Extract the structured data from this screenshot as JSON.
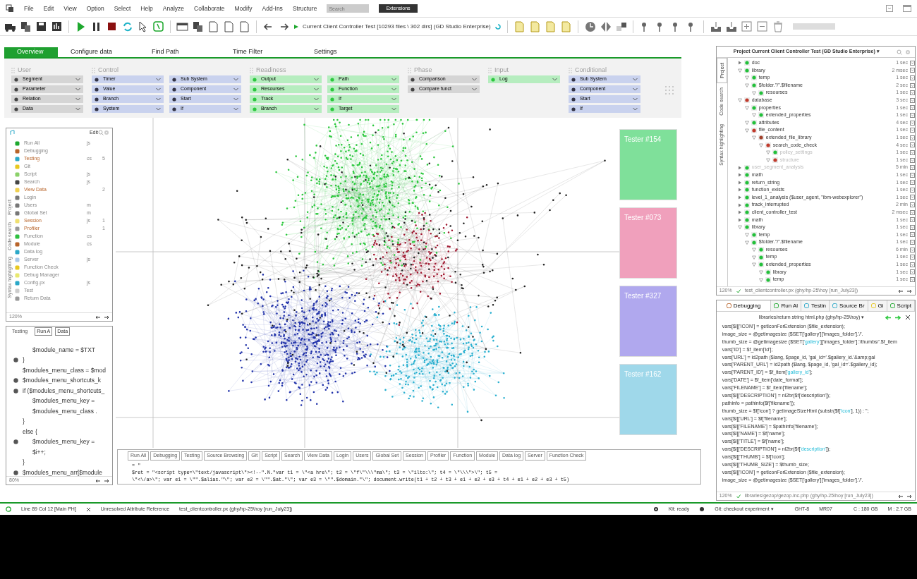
{
  "menu": [
    "File",
    "Edit",
    "View",
    "Option",
    "Select",
    "Help",
    "Analyze",
    "Collaborate",
    "Modify",
    "Add-Ins",
    "Structure"
  ],
  "menu_search": {
    "placeholder": "Search"
  },
  "extensions_button": "Extensions",
  "toolbar": {
    "project_label": "Current Client Controller Test [10293 files \\ 302 dirs] (GD Studio Enterprise)"
  },
  "tabs": [
    {
      "label": "Overview",
      "selected": true
    },
    {
      "label": "Configure data",
      "selected": false
    },
    {
      "label": "Find Path",
      "selected": false
    },
    {
      "label": "Time Filter",
      "selected": false
    },
    {
      "label": "Settings",
      "selected": false
    }
  ],
  "filter_groups": [
    {
      "title": "User",
      "kind": "grey",
      "columns": [
        [
          "Segment",
          "Parameter",
          "Relation",
          "Data"
        ]
      ]
    },
    {
      "title": "Control",
      "kind": "blue",
      "columns": [
        [
          "Timer",
          "Value",
          "Branch",
          "System"
        ],
        [
          "Sub System",
          "Component",
          "Start",
          "If"
        ]
      ]
    },
    {
      "title": "Readiness",
      "kind": "green",
      "columns": [
        [
          "Output",
          "Resourses",
          "Track",
          "Branch"
        ],
        [
          "Path",
          "Function",
          "If",
          "Target"
        ]
      ]
    },
    {
      "title": "Phase",
      "kind": "grey",
      "columns": [
        [
          "Comparison",
          "Compare funct"
        ]
      ]
    },
    {
      "title": "Input",
      "kind": "green",
      "columns": [
        [
          "Log"
        ]
      ]
    },
    {
      "title": "Conditional",
      "kind": "blue",
      "columns": [
        [
          "Sub System",
          "Component",
          "Start",
          "If"
        ]
      ]
    }
  ],
  "left_panel": {
    "header": "Edit",
    "side_tabs": [
      "Project",
      "Code search",
      "Syntax highlighting"
    ],
    "items": [
      {
        "label": "Run All",
        "type": "js",
        "highlighted": false
      },
      {
        "label": "Debugging",
        "highlighted": false
      },
      {
        "label": "Testing",
        "type": "cs",
        "count": "5",
        "highlighted": true
      },
      {
        "label": "Git",
        "highlighted": false
      },
      {
        "label": "Script",
        "type": "js",
        "highlighted": false
      },
      {
        "label": "Search",
        "type": "js",
        "highlighted": false
      },
      {
        "label": "View Data",
        "count": "2",
        "highlighted": true
      },
      {
        "label": "Login",
        "highlighted": false
      },
      {
        "label": "Users",
        "type": "m",
        "highlighted": false
      },
      {
        "label": "Global Set",
        "type": "m",
        "highlighted": false
      },
      {
        "label": "Session",
        "type": "js",
        "count": "1",
        "highlighted": true
      },
      {
        "label": "Profiler",
        "count": "1",
        "highlighted": true
      },
      {
        "label": "Function",
        "type": "cs",
        "highlighted": false
      },
      {
        "label": "Module",
        "type": "cs",
        "highlighted": false
      },
      {
        "label": "Data log",
        "highlighted": false
      },
      {
        "label": "Server",
        "type": "js",
        "highlighted": false
      },
      {
        "label": "Function Check",
        "highlighted": false
      },
      {
        "label": "Debug Manager",
        "highlighted": false
      },
      {
        "label": "Config.px",
        "type": "js",
        "highlighted": false
      },
      {
        "label": "Test",
        "highlighted": false
      },
      {
        "label": "Return Data",
        "highlighted": false
      }
    ],
    "zoom": "120%"
  },
  "code_panel": {
    "tabs": [
      "Testing",
      "Run A",
      "Data"
    ],
    "lines": [
      {
        "text": "$module_name = $TXT",
        "kind": "continued",
        "breakpoint": false
      },
      {
        "text": "}",
        "kind": "statement",
        "breakpoint": true
      },
      {
        "text": "$modules_menu_class = $mod",
        "kind": "statement",
        "breakpoint": false
      },
      {
        "text": "$modules_menu_shortcuts_k",
        "kind": "statement",
        "breakpoint": true
      },
      {
        "text": "if ($modules_menu_shortcuts_",
        "kind": "statement",
        "breakpoint": true,
        "children": [
          {
            "text": "$modules_menu_key =",
            "breakpoint": false
          },
          {
            "text": "$modules_menu_class .",
            "breakpoint": false
          }
        ]
      },
      {
        "text": "}",
        "kind": "statement",
        "breakpoint": false
      },
      {
        "text": "else {",
        "kind": "statement",
        "breakpoint": false,
        "children": [
          {
            "text": "$modules_menu_key =",
            "breakpoint": true
          },
          {
            "text": "$i++;",
            "breakpoint": false
          }
        ]
      },
      {
        "text": "}",
        "kind": "statement",
        "breakpoint": false
      },
      {
        "text": "$modules_menu_arr[$module",
        "kind": "statement",
        "breakpoint": true
      }
    ],
    "zoom": "80%"
  },
  "testers": [
    {
      "title": "Tester #154",
      "color": "#7fe09a"
    },
    {
      "title": "Tester #073",
      "color": "#f0a0bc"
    },
    {
      "title": "Tester #327",
      "color": "#b0a8ee"
    },
    {
      "title": "Tester #162",
      "color": "#9fd8ea"
    }
  ],
  "console": {
    "tabs": [
      "Run All",
      "Debugging",
      "Testing",
      "Source Browsing",
      "Git",
      "Script",
      "Search",
      "View Data",
      "Login",
      "Users",
      "Global Set",
      "Session",
      "Profiler",
      "Function",
      "Module",
      "Data log",
      "Server",
      "Function Check"
    ],
    "lines": [
      "= \"",
      "$ret = \"<script type=\\\"text/javascript\\\"><!--\".N.\"var t1 = \\\"<a hre\\\"; t2 = \\\"f\\\"\\\\\\\"ma\\\"; t3 = \\\"ilto:\\\"; t4 = \\\"\\\\\\\">\\\"; t5 =",
      "\\\"<\\/a>\\\"; var e1 = \\\"\".$alias.\"\\\"; var e2 = \\\"\".$at.\"\\\"; var e3 = \\\"\".$domain.\"\\\"; document.write(t1 + t2 + t3 + e1 + e2 + e3 + t4 + e1 + e2 + e3 + t5)"
    ]
  },
  "project_panel": {
    "title": "Project Current Client Controller Test  (GD Studio Enterprise) ▾",
    "side_tabs": [
      {
        "label": "Project",
        "selected": true
      },
      {
        "label": "Code search",
        "selected": false
      },
      {
        "label": "Syntax highlighting",
        "selected": false
      }
    ],
    "tree": [
      {
        "label": "doc",
        "time": "1 sec",
        "color": "#22c03a",
        "expanded": false,
        "dimmed": false
      },
      {
        "label": "library",
        "time": "2 msec",
        "color": "#22c03a",
        "expanded": true,
        "dimmed": false,
        "children": [
          {
            "label": "temp",
            "time": "1 sec",
            "color": "#22c03a",
            "expanded": true,
            "dimmed": false
          },
          {
            "label": "$folder.\"/\".$filename",
            "time": "2 sec",
            "color": "#22c03a",
            "expanded": true,
            "dimmed": false,
            "children": [
              {
                "label": "resourses",
                "time": "1 sec",
                "color": "#22c03a",
                "expanded": true,
                "dimmed": false
              }
            ]
          }
        ]
      },
      {
        "label": "database",
        "time": "3 sec",
        "color": "#c0392b",
        "expanded": true,
        "dimmed": false,
        "children": [
          {
            "label": "properties",
            "time": "1 sec",
            "color": "#22c03a",
            "expanded": true,
            "dimmed": false,
            "children": [
              {
                "label": "extended_properties",
                "time": "1 sec",
                "color": "#22c03a",
                "expanded": true,
                "dimmed": false
              }
            ]
          },
          {
            "label": "attributes",
            "time": "4 sec",
            "color": "#22c03a",
            "expanded": true,
            "dimmed": false
          },
          {
            "label": "file_content",
            "time": "1 sec",
            "color": "#c0392b",
            "expanded": true,
            "dimmed": false,
            "children": [
              {
                "label": "extended_file_library",
                "time": "1 sec",
                "color": "#a0402a",
                "expanded": true,
                "dimmed": false,
                "children": [
                  {
                    "label": "search_code_check",
                    "time": "4 sec",
                    "color": "#c0392b",
                    "expanded": true,
                    "dimmed": false,
                    "children": [
                      {
                        "label": "policy_settings",
                        "time": "1 sec",
                        "color": "#22c03a",
                        "expanded": true,
                        "dimmed": true
                      },
                      {
                        "label": "structure",
                        "time": "1 sec",
                        "color": "#c0392b",
                        "expanded": true,
                        "dimmed": true
                      }
                    ]
                  }
                ]
              }
            ]
          }
        ]
      },
      {
        "label": "user_segment_analysis",
        "time": "5 min",
        "color": "#22c03a",
        "expanded": false,
        "dimmed": true
      },
      {
        "label": "math",
        "time": "1 sec",
        "color": "#22c03a",
        "expanded": false,
        "dimmed": false
      },
      {
        "label": "return_string",
        "time": "1 sec",
        "color": "#22c03a",
        "expanded": false,
        "dimmed": false
      },
      {
        "label": "function_exists",
        "time": "1 sec",
        "color": "#22c03a",
        "expanded": false,
        "dimmed": false
      },
      {
        "label": "level_1_analysis ($user_agent, \"ibm-webexplorer\")",
        "time": "1 sec",
        "color": "#22c03a",
        "expanded": false,
        "dimmed": false
      },
      {
        "label": "track_interrupted",
        "time": "2 min",
        "color": "#22c03a",
        "expanded": false,
        "dimmed": false
      },
      {
        "label": "client_controller_test",
        "time": "2 msec",
        "color": "#22c03a",
        "expanded": false,
        "dimmed": false
      },
      {
        "label": "math",
        "time": "1 sec",
        "color": "#22c03a",
        "expanded": false,
        "dimmed": false
      },
      {
        "label": "library",
        "time": "1 sec",
        "color": "#22c03a",
        "expanded": true,
        "dimmed": false,
        "children": [
          {
            "label": "temp",
            "time": "1 sec",
            "color": "#22c03a",
            "expanded": true,
            "dimmed": false
          },
          {
            "label": "$folder.\"/\".$filename",
            "time": "1 sec",
            "color": "#22c03a",
            "expanded": true,
            "dimmed": false,
            "children": [
              {
                "label": "resourses",
                "time": "6 min",
                "color": "#22c03a",
                "expanded": true,
                "dimmed": false
              },
              {
                "label": "temp",
                "time": "1 sec",
                "color": "#22c03a",
                "expanded": true,
                "dimmed": false
              },
              {
                "label": "extended_properties",
                "time": "1 sec",
                "color": "#22c03a",
                "expanded": true,
                "dimmed": false,
                "children": [
                  {
                    "label": "library",
                    "time": "1 sec",
                    "color": "#22c03a",
                    "expanded": true,
                    "dimmed": false
                  },
                  {
                    "label": "temp",
                    "time": "1 sec",
                    "color": "#22c03a",
                    "expanded": true,
                    "dimmed": false
                  }
                ]
              }
            ]
          }
        ]
      }
    ],
    "zoom": "120%",
    "file": "test_clientcontroller.px (ghy/hp-25\\hoy [run_July23])"
  },
  "source_panel": {
    "tabs": [
      {
        "label": "Debugging",
        "selected": true
      },
      {
        "label": "Run Al",
        "selected": false
      },
      {
        "label": "Testin",
        "selected": false
      },
      {
        "label": "Source Br",
        "selected": false
      },
      {
        "label": "Gi",
        "selected": false
      },
      {
        "label": "Script",
        "selected": false
      }
    ],
    "path": "libraries/return string html.php (ghy/hp-25\\hoy) ▾",
    "lines": [
      [
        {
          "text": "vars[$i]['ICON'] = getIconForExtension ($file_extension);",
          "highlighted": false
        }
      ],
      [
        {
          "text": "image_size = @getimagesize ($SET['gallery']['images_folder'].'/'.",
          "highlighted": false
        }
      ],
      [
        {
          "text": "thumb_size = @getimagesize ($SET[",
          "highlighted": false
        },
        {
          "text": "'gallery'",
          "highlighted": true
        },
        {
          "text": "]['images_folder'].'/thumbs/'.$f_item",
          "highlighted": false
        }
      ],
      [
        {
          "text": "vars['ID'] = $f_item['id'];",
          "highlighted": false
        }
      ],
      [
        {
          "text": "vars['URL'] = id2path ($lang, $page_id, 'gal_id='.$gallery_id.'&amp;gal",
          "highlighted": false
        }
      ],
      [
        {
          "text": "vars['PARENT_URL'] = id2path ($lang, $page_id, 'gal_id='.$gallery_id);",
          "highlighted": false
        }
      ],
      [
        {
          "text": "vars['PARENT_ID'] = $f_item[",
          "highlighted": false
        },
        {
          "text": "'gallery_id'",
          "highlighted": true
        },
        {
          "text": "];",
          "highlighted": false
        }
      ],
      [
        {
          "text": "vars['DATE'] = $f_item['date_format'];",
          "highlighted": false
        }
      ],
      [
        {
          "text": "vars['FILENAME'] = $f_item['filename'];",
          "highlighted": false
        }
      ],
      [
        {
          "text": "vars[$i]['DESCRIPTION'] = nl2br($f['description']);",
          "highlighted": false
        }
      ],
      [
        {
          "text": "pathinfo = pathinfo($f['filename']);",
          "highlighted": false
        }
      ],
      [
        {
          "text": "thumb_size = $f['icon'] ? getImageSizeHtml (substr($f[",
          "highlighted": false
        },
        {
          "text": "'icon'",
          "highlighted": true
        },
        {
          "text": "], 1)) : '';",
          "highlighted": false
        }
      ],
      [
        {
          "text": "vars[$i]['URL'] = $f['filename'];",
          "highlighted": false
        }
      ],
      [
        {
          "text": "vars[$i]['FILENAME'] = $pathinfo['filename'];",
          "highlighted": false
        }
      ],
      [
        {
          "text": "vars[$i]['NAME'] = $f['name'];",
          "highlighted": false
        }
      ],
      [
        {
          "text": "vars[$i]['TITLE'] = $f['name'];",
          "highlighted": false
        }
      ],
      [
        {
          "text": "vars[$i]['DESCRIPTION'] = nl2br($f[",
          "highlighted": false
        },
        {
          "text": "'description'",
          "highlighted": true
        },
        {
          "text": "]);",
          "highlighted": false
        }
      ],
      [
        {
          "text": "vars[$i]['THUMB'] = $f['icon'];",
          "highlighted": false
        }
      ],
      [
        {
          "text": "vars[$i]['THUMB_SIZE'] = $thumb_size;",
          "highlighted": false
        }
      ],
      [
        {
          "text": "vars[$i]['ICON'] = getIconForExtension ($file_extension);",
          "highlighted": false
        }
      ],
      [
        {
          "text": "image_size = @getimagesize ($SET['gallery']['images_folder'].'/'.",
          "highlighted": false
        }
      ]
    ],
    "zoom": "120%",
    "file": "libraries/gezop/gezop.inc.php (ghy/hp-25\\hoy [run_July23])"
  },
  "status_bar": {
    "position": "Line 89 Col 12 [Main PH]",
    "problem": "Unresolved Attribute Reference",
    "file": "test_clientcontroller.px (ghy/hp-25\\hoy [run_July23])",
    "kit": "Kit: ready",
    "git": "Git: checkout experiment ▾",
    "branch": "GHT-8",
    "build": "MR07",
    "disk": "C : 180 GB",
    "memory": "M : 2.7 GB"
  }
}
